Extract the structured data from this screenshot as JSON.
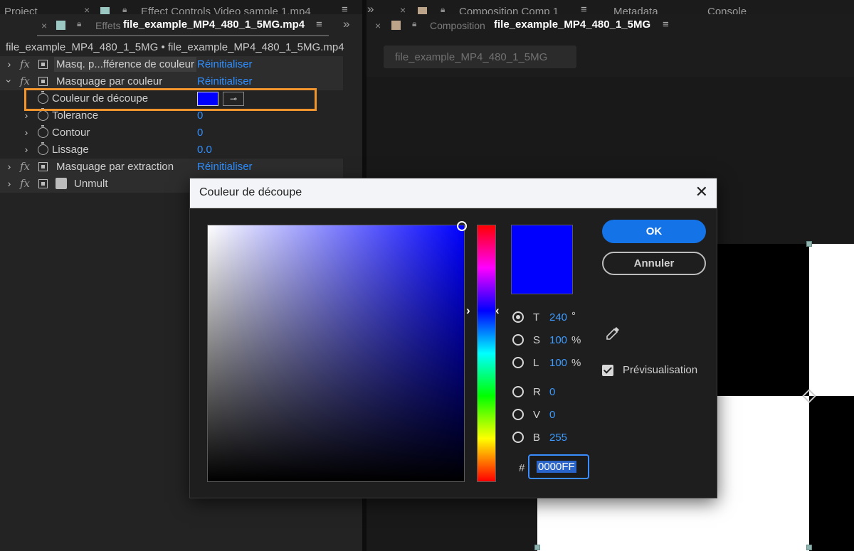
{
  "top_strip": {
    "left_tabs": [
      "Project",
      "Effect Controls Video sample 1.mp4"
    ],
    "right_tabs": [
      "Composition Comp 1",
      "Metadata",
      "Console"
    ]
  },
  "left_panel": {
    "tab_close": "×",
    "tab_dim": "Effets",
    "tab_active": "file_example_MP4_480_1_5MG.mp4",
    "breadcrumb": "file_example_MP4_480_1_5MG • file_example_MP4_480_1_5MG.mp4",
    "effects": [
      {
        "name": "Masq. p...fférence de couleur",
        "action": "Réinitialiser"
      },
      {
        "name": "Masquage par couleur",
        "action": "Réinitialiser"
      },
      {
        "name": "Masquage par extraction",
        "action": "Réinitialiser"
      },
      {
        "name": "Unmult",
        "action": ""
      }
    ],
    "properties": [
      {
        "name": "Couleur de découpe",
        "value": ""
      },
      {
        "name": "Tolerance",
        "value": "0"
      },
      {
        "name": "Contour",
        "value": "0"
      },
      {
        "name": "Lissage",
        "value": "0.0"
      }
    ],
    "key_color": "#0000ff"
  },
  "right_panel": {
    "tab_close": "×",
    "tab_dim": "Composition",
    "tab_active": "file_example_MP4_480_1_5MG",
    "comp_chip": "file_example_MP4_480_1_5MG"
  },
  "dialog": {
    "title": "Couleur de découpe",
    "close": "✕",
    "ok": "OK",
    "cancel": "Annuler",
    "preview_color": "#0000ff",
    "fields": [
      {
        "label": "T",
        "value": "240",
        "unit": "°",
        "selected": true
      },
      {
        "label": "S",
        "value": "100",
        "unit": "%",
        "selected": false
      },
      {
        "label": "L",
        "value": "100",
        "unit": "%",
        "selected": false
      },
      {
        "label": "R",
        "value": "0",
        "unit": "",
        "selected": false
      },
      {
        "label": "V",
        "value": "0",
        "unit": "",
        "selected": false
      },
      {
        "label": "B",
        "value": "255",
        "unit": "",
        "selected": false
      }
    ],
    "hex_prefix": "#",
    "hex_value": "0000FF",
    "preview_checkbox_label": "Prévisualisation",
    "preview_checked": true
  },
  "colors": {
    "accent_blue": "#1473e6",
    "link_blue": "#2f8fff",
    "highlight_orange": "#f2952c"
  }
}
